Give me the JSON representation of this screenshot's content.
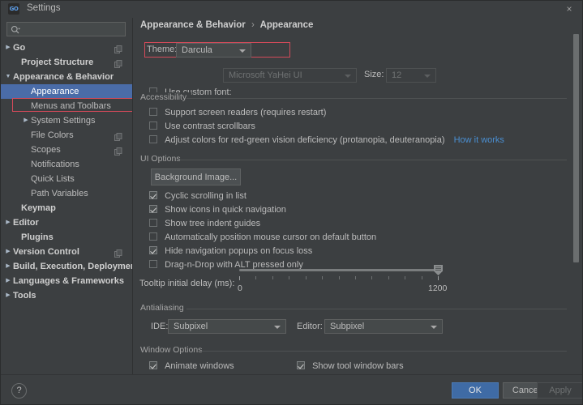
{
  "window": {
    "title": "Settings",
    "app_icon": "goland-icon",
    "close_label": "×"
  },
  "search": {
    "value": "",
    "placeholder": ""
  },
  "sidebar": {
    "items": [
      {
        "label": "Go",
        "arrow": "▶",
        "bold": true,
        "indent": 16,
        "copy": true,
        "selected": false
      },
      {
        "label": "Project Structure",
        "arrow": "",
        "bold": true,
        "indent": 26,
        "copy": true,
        "selected": false
      },
      {
        "label": "Appearance & Behavior",
        "arrow": "▼",
        "bold": true,
        "indent": 16,
        "copy": false,
        "selected": false
      },
      {
        "label": "Appearance",
        "arrow": "",
        "bold": false,
        "indent": 38,
        "copy": false,
        "selected": true
      },
      {
        "label": "Menus and Toolbars",
        "arrow": "",
        "bold": false,
        "indent": 38,
        "copy": false,
        "selected": false
      },
      {
        "label": "System Settings",
        "arrow": "▶",
        "bold": false,
        "indent": 38,
        "copy": false,
        "selected": false
      },
      {
        "label": "File Colors",
        "arrow": "",
        "bold": false,
        "indent": 38,
        "copy": true,
        "selected": false
      },
      {
        "label": "Scopes",
        "arrow": "",
        "bold": false,
        "indent": 38,
        "copy": true,
        "selected": false
      },
      {
        "label": "Notifications",
        "arrow": "",
        "bold": false,
        "indent": 38,
        "copy": false,
        "selected": false
      },
      {
        "label": "Quick Lists",
        "arrow": "",
        "bold": false,
        "indent": 38,
        "copy": false,
        "selected": false
      },
      {
        "label": "Path Variables",
        "arrow": "",
        "bold": false,
        "indent": 38,
        "copy": false,
        "selected": false
      },
      {
        "label": "Keymap",
        "arrow": "",
        "bold": true,
        "indent": 26,
        "copy": false,
        "selected": false
      },
      {
        "label": "Editor",
        "arrow": "▶",
        "bold": true,
        "indent": 16,
        "copy": false,
        "selected": false
      },
      {
        "label": "Plugins",
        "arrow": "",
        "bold": true,
        "indent": 26,
        "copy": false,
        "selected": false
      },
      {
        "label": "Version Control",
        "arrow": "▶",
        "bold": true,
        "indent": 16,
        "copy": true,
        "selected": false
      },
      {
        "label": "Build, Execution, Deployment",
        "arrow": "▶",
        "bold": true,
        "indent": 16,
        "copy": false,
        "selected": false
      },
      {
        "label": "Languages & Frameworks",
        "arrow": "▶",
        "bold": true,
        "indent": 16,
        "copy": false,
        "selected": false
      },
      {
        "label": "Tools",
        "arrow": "▶",
        "bold": true,
        "indent": 16,
        "copy": false,
        "selected": false
      }
    ]
  },
  "breadcrumb": {
    "root": "Appearance & Behavior",
    "separator": "›",
    "current": "Appearance"
  },
  "theme": {
    "label": "Theme:",
    "value": "Darcula"
  },
  "custom_font": {
    "label": "Use custom font:",
    "checked": false,
    "font_value": "Microsoft YaHei UI",
    "size_label": "Size:",
    "size_value": "12"
  },
  "accessibility": {
    "title": "Accessibility",
    "options": [
      {
        "label": "Support screen readers (requires restart)",
        "checked": false
      },
      {
        "label": "Use contrast scrollbars",
        "checked": false
      },
      {
        "label": "Adjust colors for red-green vision deficiency (protanopia, deuteranopia)",
        "checked": false
      }
    ],
    "link": "How it works"
  },
  "ui_options": {
    "title": "UI Options",
    "background_image_button": "Background Image...",
    "options": [
      {
        "label": "Cyclic scrolling in list",
        "checked": true
      },
      {
        "label": "Show icons in quick navigation",
        "checked": true
      },
      {
        "label": "Show tree indent guides",
        "checked": false
      },
      {
        "label": "Automatically position mouse cursor on default button",
        "checked": false
      },
      {
        "label": "Hide navigation popups on focus loss",
        "checked": true
      },
      {
        "label": "Drag-n-Drop with ALT pressed only",
        "checked": false
      }
    ],
    "tooltip_delay": {
      "label": "Tooltip initial delay (ms):",
      "min": "0",
      "max": "1200",
      "value": 1200,
      "ticks": 13
    }
  },
  "antialiasing": {
    "title": "Antialiasing",
    "ide_label": "IDE:",
    "ide_value": "Subpixel",
    "editor_label": "Editor:",
    "editor_value": "Subpixel"
  },
  "window_options": {
    "title": "Window Options",
    "animate_windows": {
      "label": "Animate windows",
      "checked": true
    },
    "show_tool_window_bars": {
      "label": "Show tool window bars",
      "checked": true
    }
  },
  "footer": {
    "help_label": "?",
    "ok_label": "OK",
    "cancel_label": "Cancel",
    "apply_label": "Apply"
  },
  "colors": {
    "background": "#3c3f41",
    "selection_blue": "#4a6ca8",
    "accent_button": "#3f6ba5",
    "annotation_red": "#d44a5a",
    "link_blue": "#4a8ed0",
    "text": "#bbbbbb"
  }
}
